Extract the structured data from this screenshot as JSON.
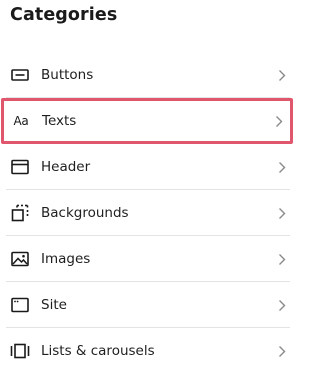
{
  "panel": {
    "title": "Categories"
  },
  "categories": [
    {
      "label": "Buttons",
      "icon": "button-icon",
      "selected": false
    },
    {
      "label": "Texts",
      "icon": "text-aa-icon",
      "icon_text": "Aa",
      "selected": true
    },
    {
      "label": "Header",
      "icon": "header-icon",
      "selected": false
    },
    {
      "label": "Backgrounds",
      "icon": "background-icon",
      "selected": false
    },
    {
      "label": "Images",
      "icon": "image-icon",
      "selected": false
    },
    {
      "label": "Site",
      "icon": "site-window-icon",
      "selected": false
    },
    {
      "label": "Lists & carousels",
      "icon": "carousel-icon",
      "selected": false
    }
  ],
  "colors": {
    "selected_border": "#e0566c",
    "divider": "#e4e4e4",
    "text": "#1f1f1f",
    "chevron": "#8a8a8a"
  }
}
